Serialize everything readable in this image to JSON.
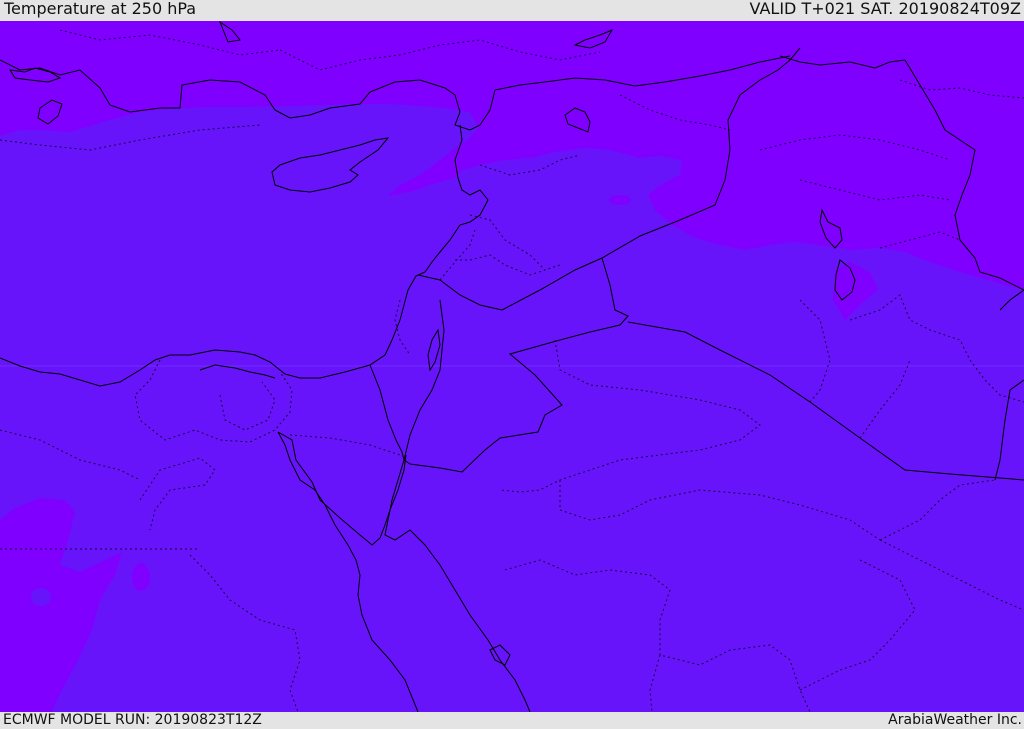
{
  "header": {
    "title": "Temperature at 250 hPa",
    "valid_time": "VALID T+021 SAT. 20190824T09Z"
  },
  "footer": {
    "model_run": "ECMWF MODEL RUN: 20190823T12Z",
    "credit": "ArabiaWeather Inc."
  },
  "map": {
    "field": "temperature",
    "pressure_level_hpa": 250,
    "colors": {
      "base_field": "#6714fb",
      "cold_field": "#8000ff",
      "coastline": "#000000",
      "border": "#000000"
    }
  }
}
